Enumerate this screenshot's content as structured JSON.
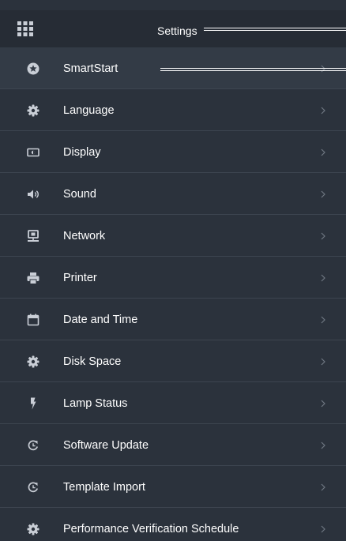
{
  "header": {
    "title": "Settings",
    "menu_icon": "grid-icon"
  },
  "menu": {
    "items": [
      {
        "label": "SmartStart",
        "icon": "star-icon",
        "selected": true
      },
      {
        "label": "Language",
        "icon": "gear-icon"
      },
      {
        "label": "Display",
        "icon": "display-icon"
      },
      {
        "label": "Sound",
        "icon": "speaker-icon"
      },
      {
        "label": "Network",
        "icon": "network-icon"
      },
      {
        "label": "Printer",
        "icon": "printer-icon"
      },
      {
        "label": "Date and Time",
        "icon": "calendar-icon"
      },
      {
        "label": "Disk Space",
        "icon": "gear-icon"
      },
      {
        "label": "Lamp Status",
        "icon": "lightning-icon"
      },
      {
        "label": "Software Update",
        "icon": "refresh-icon"
      },
      {
        "label": "Template Import",
        "icon": "refresh-icon"
      },
      {
        "label": "Performance Verification Schedule",
        "icon": "gear-icon"
      }
    ],
    "chevron_icon": "chevron-right-icon"
  },
  "colors": {
    "panel_bg": "#2b323c",
    "header_bg": "#262c35",
    "selected_bg": "#333b46",
    "divider": "#3d4550",
    "icon": "#c9ced6",
    "chevron": "#6f7782",
    "text": "#ffffff"
  }
}
